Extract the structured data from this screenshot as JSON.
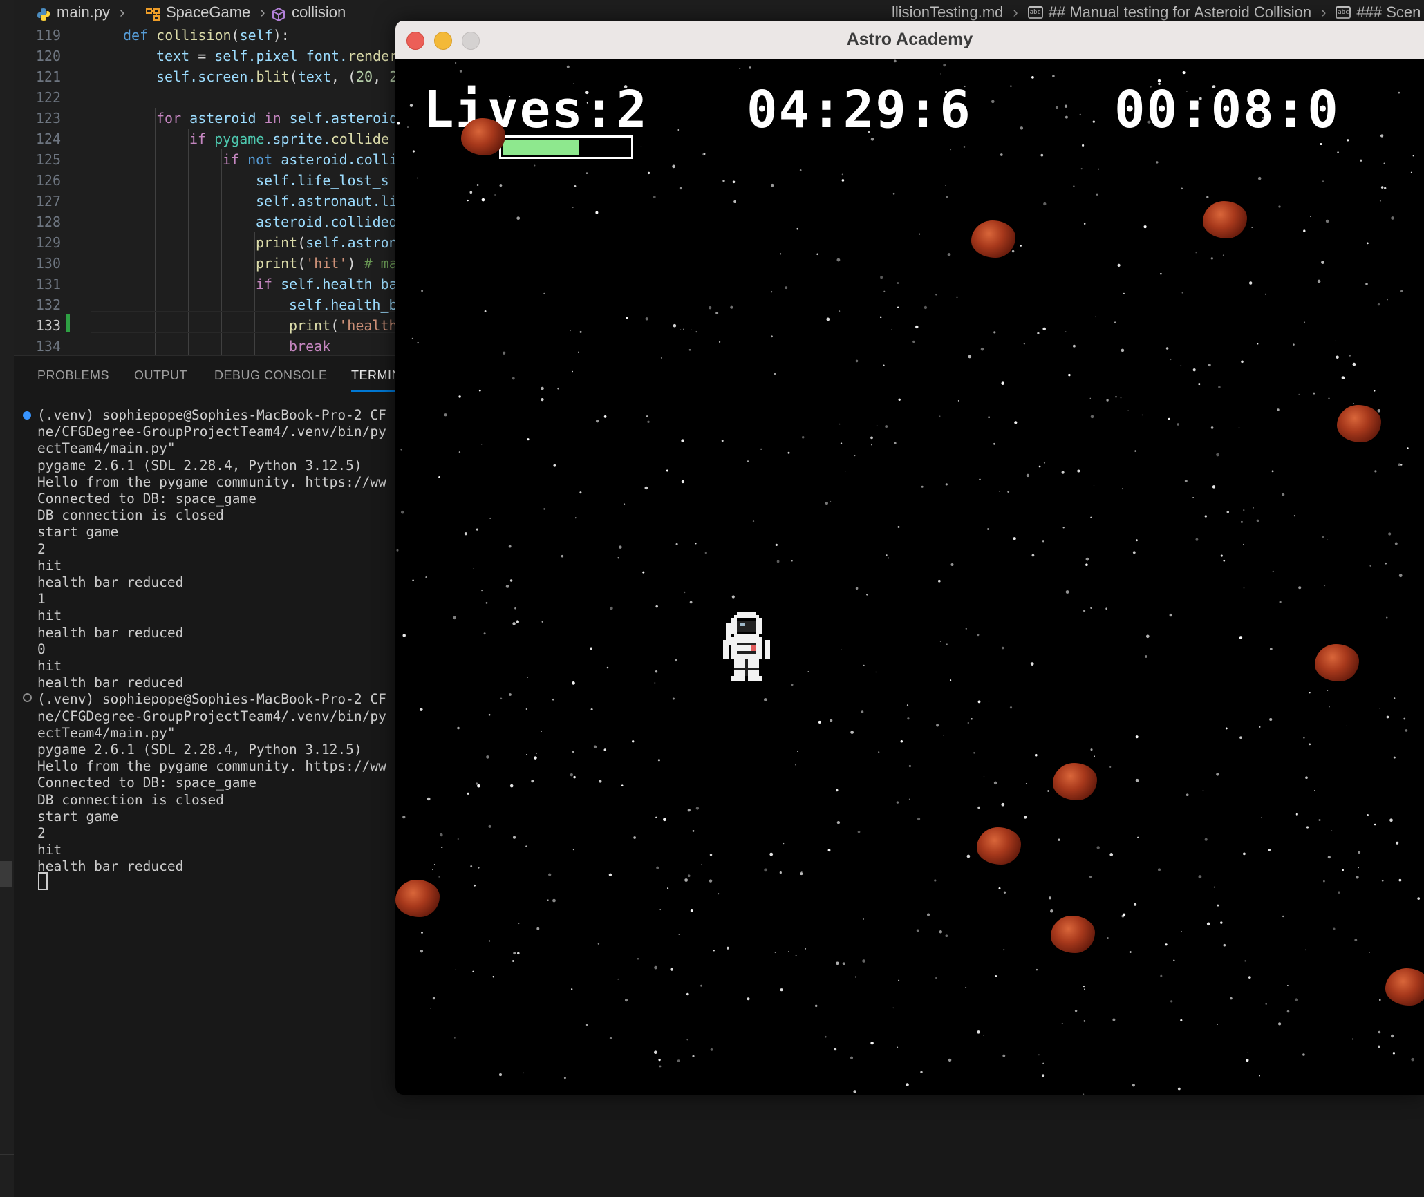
{
  "breadcrumb": {
    "file": "main.py",
    "class": "SpaceGame",
    "method": "collision",
    "right_file": "llisionTesting.md",
    "right_heading": "## Manual testing for Asteroid Collision",
    "right_sub": "### Scen"
  },
  "editor": {
    "line_numbers": [
      "119",
      "120",
      "121",
      "122",
      "123",
      "124",
      "125",
      "126",
      "127",
      "128",
      "129",
      "130",
      "131",
      "132",
      "133",
      "134"
    ],
    "active_line": "133"
  },
  "panel": {
    "tabs": [
      "PROBLEMS",
      "OUTPUT",
      "DEBUG CONSOLE",
      "TERMIN"
    ]
  },
  "terminal": {
    "lines": [
      "(.venv) sophiepope@Sophies-MacBook-Pro-2 CF",
      "ne/CFGDegree-GroupProjectTeam4/.venv/bin/py",
      "ectTeam4/main.py\"",
      "pygame 2.6.1 (SDL 2.28.4, Python 3.12.5)",
      "Hello from the pygame community. https://ww",
      "Connected to DB: space_game",
      "DB connection is closed",
      "start game",
      "2",
      "hit",
      "health bar reduced",
      "1",
      "hit",
      "health bar reduced",
      "0",
      "hit",
      "health bar reduced",
      "(.venv) sophiepope@Sophies-MacBook-Pro-2 CF",
      "ne/CFGDegree-GroupProjectTeam4/.venv/bin/py",
      "ectTeam4/main.py\"",
      "pygame 2.6.1 (SDL 2.28.4, Python 3.12.5)",
      "Hello from the pygame community. https://ww",
      "Connected to DB: space_game",
      "DB connection is closed",
      "start game",
      "2",
      "hit",
      "health bar reduced"
    ]
  },
  "game": {
    "window_title": "Astro Academy",
    "lives_text": "Lives:2",
    "timer_1": "04:29:6",
    "timer_2": "00:08:0",
    "health_fraction": 0.6,
    "health_color": "#8ee88e"
  }
}
